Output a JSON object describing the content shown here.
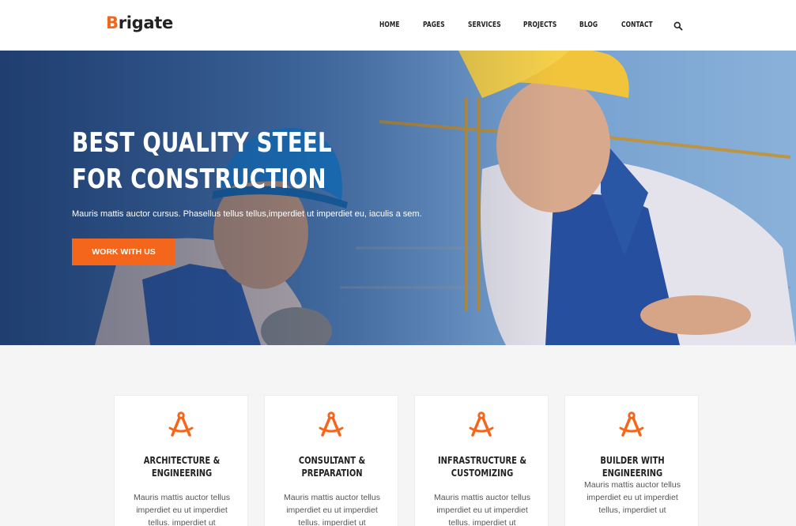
{
  "brand": {
    "first": "B",
    "rest": "rigate",
    "accent_color": "#f4661b"
  },
  "nav": [
    {
      "label": "HOME"
    },
    {
      "label": "PAGES"
    },
    {
      "label": "SERVICES"
    },
    {
      "label": "PROJECTS"
    },
    {
      "label": "BLOG"
    },
    {
      "label": "CONTACT"
    }
  ],
  "search_icon": "search-icon",
  "hero": {
    "title": "BEST QUALITY STEEL FOR CONSTRUCTION",
    "subtitle": "Mauris mattis auctor cursus. Phasellus tellus tellus,imperdiet ut imperdiet eu, iaculis a sem.",
    "button": "WORK WITH US"
  },
  "services": [
    {
      "icon": "compass-icon",
      "title": "ARCHITECTURE & ENGINEERING",
      "text": "Mauris mattis auctor tellus imperdiet eu ut imperdiet tellus. imperdiet ut"
    },
    {
      "icon": "compass-icon",
      "title": "CONSULTANT & PREPARATION",
      "text": "Mauris mattis auctor tellus imperdiet eu ut imperdiet tellus. imperdiet ut"
    },
    {
      "icon": "compass-icon",
      "title": "INFRASTRUCTURE & CUSTOMIZING",
      "text": "Mauris mattis auctor tellus imperdiet eu ut imperdiet tellus. imperdiet ut"
    },
    {
      "icon": "compass-icon",
      "title": "BUILDER WITH ENGINEERING",
      "text": "Mauris mattis auctor tellus imperdiet eu ut imperdiet tellus, imperdiet ut"
    }
  ]
}
